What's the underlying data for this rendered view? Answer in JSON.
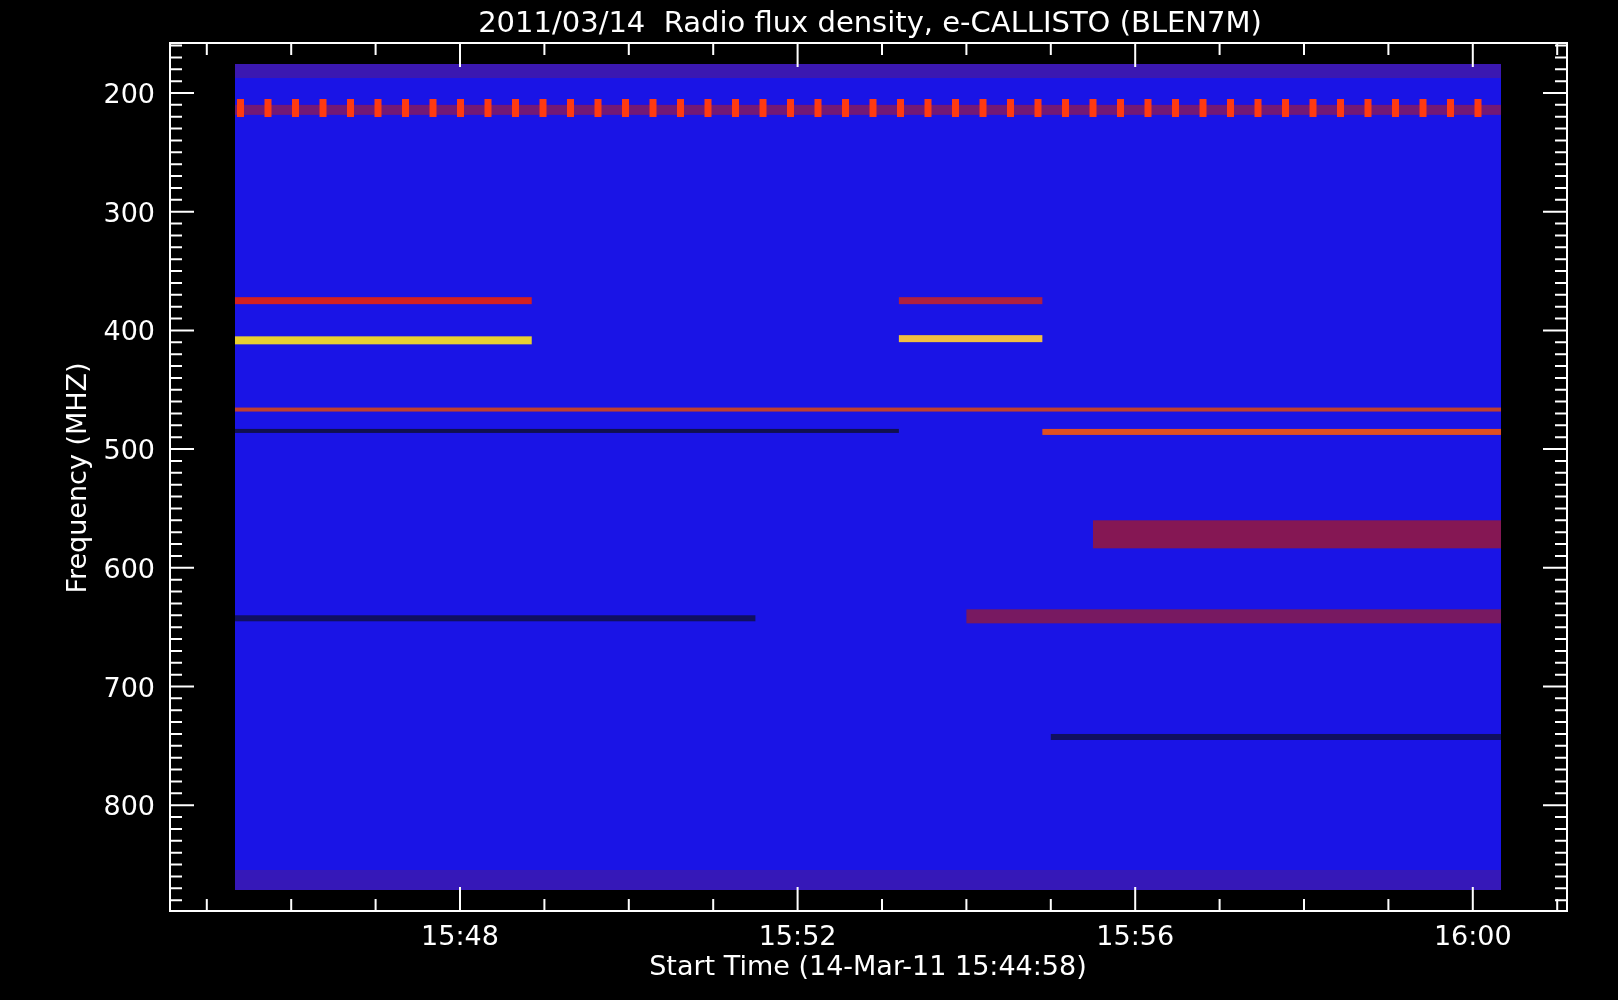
{
  "plot": {
    "title": "2011/03/14  Radio flux density, e-CALLISTO (BLEN7M)",
    "ylabel": "Frequency (MHZ)",
    "xlabel": "Start Time (14-Mar-11 15:44:58)",
    "y_tick_labels": [
      "200",
      "300",
      "400",
      "500",
      "600",
      "700",
      "800"
    ],
    "x_tick_labels": [
      "15:48",
      "15:52",
      "15:56",
      "16:00"
    ]
  }
}
